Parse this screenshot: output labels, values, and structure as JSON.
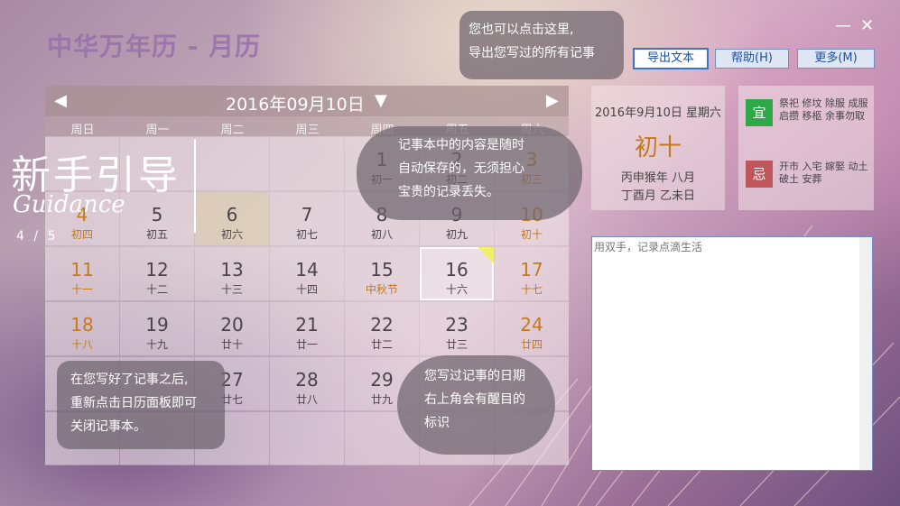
{
  "app": {
    "title": "中华万年历 - 月历"
  },
  "window": {
    "minimize": "—",
    "close": "✕"
  },
  "toolbar": {
    "export": "导出文本",
    "help": "帮助(H)",
    "more": "更多(M)"
  },
  "calendar": {
    "title": "2016年09月10日",
    "weekdays": [
      "周日",
      "周一",
      "周二",
      "周三",
      "周四",
      "周五",
      "周六"
    ],
    "days": [
      {
        "d": "",
        "l": ""
      },
      {
        "d": "",
        "l": ""
      },
      {
        "d": "",
        "l": ""
      },
      {
        "d": "",
        "l": ""
      },
      {
        "d": "1",
        "l": "初一"
      },
      {
        "d": "2",
        "l": "初二"
      },
      {
        "d": "3",
        "l": "初三"
      },
      {
        "d": "4",
        "l": "初四"
      },
      {
        "d": "5",
        "l": "初五"
      },
      {
        "d": "6",
        "l": "初六"
      },
      {
        "d": "7",
        "l": "初七"
      },
      {
        "d": "8",
        "l": "初八"
      },
      {
        "d": "9",
        "l": "初九"
      },
      {
        "d": "10",
        "l": "初十"
      },
      {
        "d": "11",
        "l": "十一"
      },
      {
        "d": "12",
        "l": "十二"
      },
      {
        "d": "13",
        "l": "十三"
      },
      {
        "d": "14",
        "l": "十四"
      },
      {
        "d": "15",
        "l": "中秋节"
      },
      {
        "d": "16",
        "l": "十六"
      },
      {
        "d": "17",
        "l": "十七"
      },
      {
        "d": "18",
        "l": "十八"
      },
      {
        "d": "19",
        "l": "十九"
      },
      {
        "d": "20",
        "l": "廿十"
      },
      {
        "d": "21",
        "l": "廿一"
      },
      {
        "d": "22",
        "l": "廿二"
      },
      {
        "d": "23",
        "l": "廿三"
      },
      {
        "d": "24",
        "l": "廿四"
      },
      {
        "d": "",
        "l": ""
      },
      {
        "d": "",
        "l": ""
      },
      {
        "d": "27",
        "l": "廿七"
      },
      {
        "d": "28",
        "l": "廿八"
      },
      {
        "d": "29",
        "l": "廿九"
      },
      {
        "d": "",
        "l": ""
      },
      {
        "d": "",
        "l": ""
      },
      {
        "d": "",
        "l": ""
      },
      {
        "d": "",
        "l": ""
      },
      {
        "d": "",
        "l": ""
      },
      {
        "d": "",
        "l": ""
      },
      {
        "d": "",
        "l": ""
      },
      {
        "d": "",
        "l": ""
      },
      {
        "d": "",
        "l": ""
      }
    ]
  },
  "guide": {
    "title": "新手引导",
    "subtitle": "Guidance",
    "page": "4 / 5"
  },
  "tips": {
    "export": [
      "您也可以点击这里,",
      "导出您写过的所有记事"
    ],
    "autosave": [
      "记事本中的内容是随时",
      "自动保存的，无须担心",
      "宝贵的记录丢失。"
    ],
    "close": [
      "在您写好了记事之后,",
      "重新点击日历面板即可",
      "关闭记事本。"
    ],
    "mark": [
      "您写过记事的日期",
      "右上角会有醒目的",
      "标识"
    ]
  },
  "detail": {
    "date": "2016年9月10日 星期六",
    "lunar": "初十",
    "ganzhi1": "丙申猴年 八月",
    "ganzhi2": "丁酉月 乙未日"
  },
  "yiji": {
    "yi_label": "宜",
    "yi_text": "祭祀 修坟 除服 成服 启攒 移柩 余事勿取",
    "ji_label": "忌",
    "ji_text": "开市 入宅 嫁娶 动土 破土 安葬",
    "yi_color": "#2fa84a",
    "ji_color": "#c0565b"
  },
  "note": {
    "placeholder": "用双手，记录点滴生活"
  }
}
